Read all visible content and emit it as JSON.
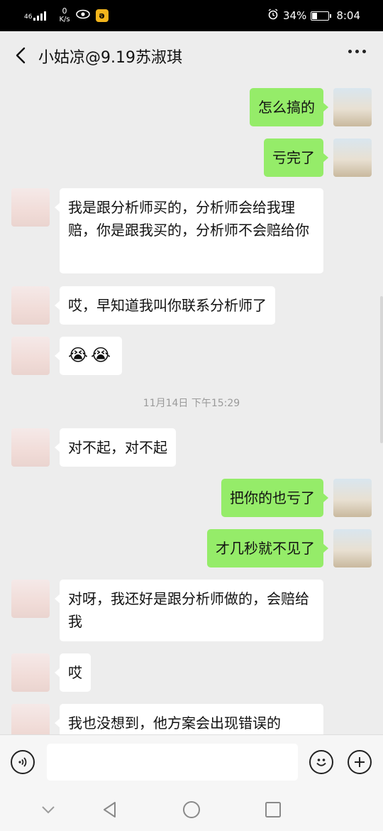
{
  "status": {
    "network": "46",
    "speed_value": "0",
    "speed_unit": "K/s",
    "battery": "34%",
    "battery_level": 0.34,
    "time": "8:04"
  },
  "header": {
    "title": "小姑凉@9.19苏淑琪"
  },
  "messages": [
    {
      "from": "me",
      "text": "怎么搞的"
    },
    {
      "from": "me",
      "text": "亏完了"
    },
    {
      "from": "her",
      "text": "我是跟分析师买的，分析师会给我理赔，你是跟我买的，分析师不会赔给你"
    },
    {
      "from": "her",
      "text": "哎，早知道我叫你联系分析师了"
    },
    {
      "from": "her",
      "text": "😭😭"
    },
    {
      "from": "her",
      "text": "对不起，对不起"
    },
    {
      "from": "me",
      "text": "把你的也亏了"
    },
    {
      "from": "me",
      "text": "才几秒就不见了"
    },
    {
      "from": "her",
      "text": "对呀，我还好是跟分析师做的，会赔给我"
    },
    {
      "from": "her",
      "text": "哎"
    },
    {
      "from": "her",
      "text": "我也没想到，他方案会出现错误的"
    }
  ],
  "timestamp": "11月14日 下午15:29",
  "input": {
    "value": "",
    "placeholder": ""
  },
  "icons": {
    "back": "chevron-left-icon",
    "more": "more-dots-icon",
    "voice": "voice-icon",
    "emoji": "emoji-icon",
    "add": "add-icon",
    "nav_down": "chevron-down-icon",
    "nav_back": "triangle-back-icon",
    "nav_home": "circle-home-icon",
    "nav_recent": "square-recent-icon"
  },
  "colors": {
    "my_bubble": "#95ec69",
    "her_bubble": "#ffffff",
    "background": "#ededed"
  }
}
